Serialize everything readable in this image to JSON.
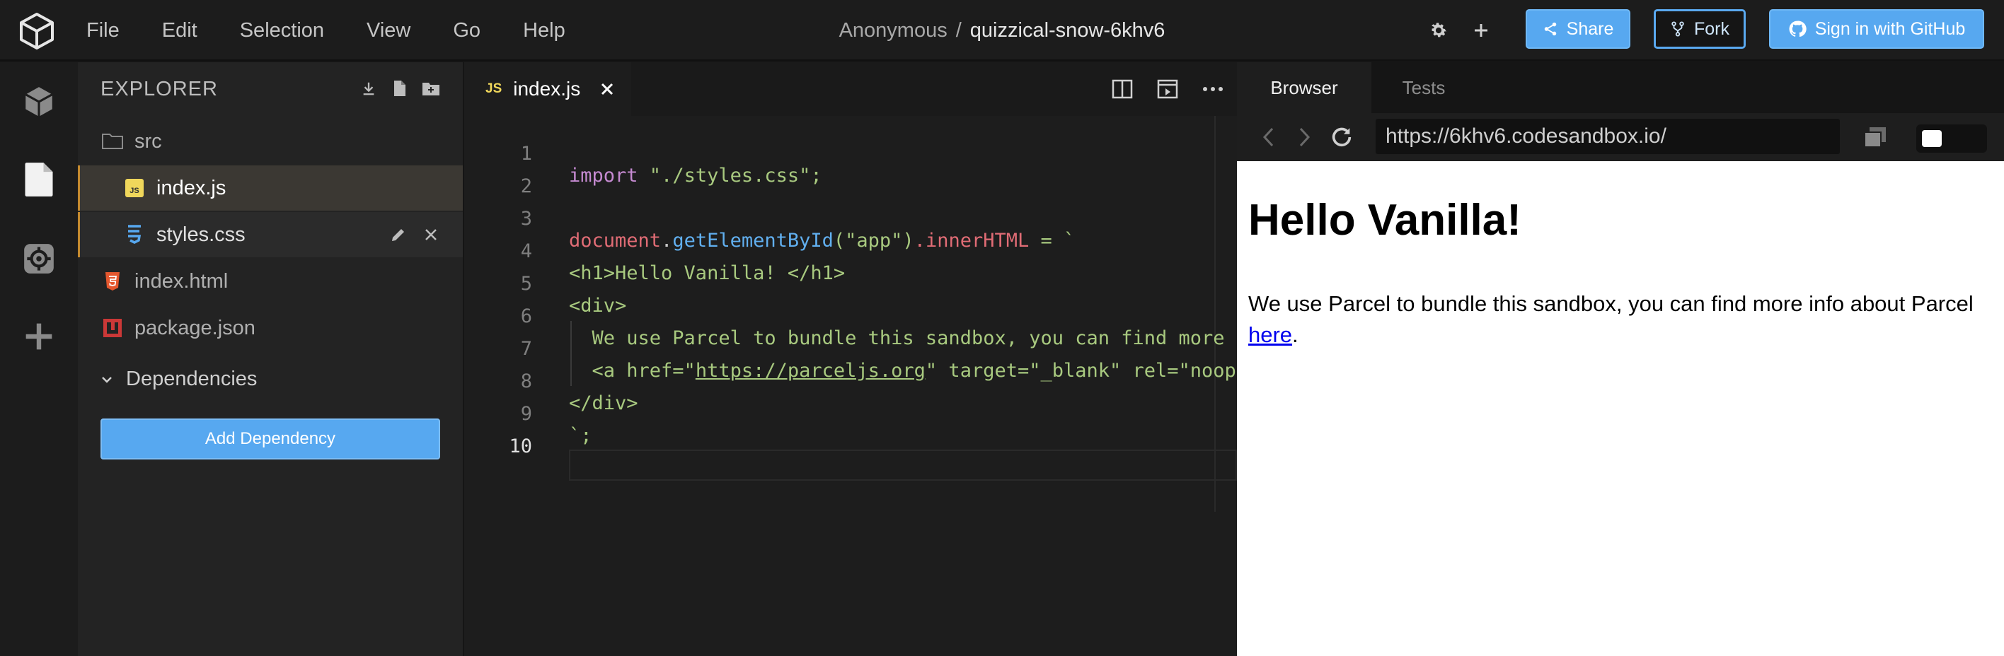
{
  "menu": [
    "File",
    "Edit",
    "Selection",
    "View",
    "Go",
    "Help"
  ],
  "project": {
    "user": "Anonymous",
    "separator": "/",
    "name": "quizzical-snow-6khv6"
  },
  "buttons": {
    "share": "Share",
    "fork": "Fork",
    "github": "Sign in with GitHub"
  },
  "explorer": {
    "title": "EXPLORER",
    "files": [
      {
        "name": "src",
        "icon": "folder-icon"
      },
      {
        "name": "index.js",
        "icon": "js-file-icon"
      },
      {
        "name": "styles.css",
        "icon": "css-file-icon"
      },
      {
        "name": "index.html",
        "icon": "html-file-icon"
      },
      {
        "name": "package.json",
        "icon": "npm-package-icon"
      }
    ],
    "dependencies_label": "Dependencies",
    "add_dependency": "Add Dependency"
  },
  "editor": {
    "tab": {
      "badge": "JS",
      "label": "index.js"
    },
    "line_numbers": [
      "1",
      "2",
      "3",
      "4",
      "5",
      "6",
      "7",
      "8",
      "9",
      "10"
    ],
    "lines": {
      "l1": {
        "kw": "import",
        "str": " \"./styles.css\";"
      },
      "l3": {
        "ident": "document",
        "dot": ".",
        "fn": "getElementById",
        "arg": "(\"app\")",
        "prop": ".innerHTML",
        "eq": " = `"
      },
      "l4": "<h1>Hello Vanilla! </h1>",
      "l5": "<div>",
      "l6": "  We use Parcel to bundle this sandbox, you can find more info about",
      "l7a": "  <a href=\"",
      "l7url": "https://parceljs.org",
      "l7b": "\" target=\"_blank\" rel=\"noopener noreferrer\">here</a>.",
      "l8": "</div>",
      "l9": "`;"
    }
  },
  "browser": {
    "tabs": [
      "Browser",
      "Tests"
    ],
    "url": "https://6khv6.codesandbox.io/",
    "heading": "Hello Vanilla!",
    "paragraph_text": "We use Parcel to bundle this sandbox, you can find more info about Parcel ",
    "link_text": "here",
    "paragraph_end": "."
  },
  "colors": {
    "accent": "#57a8f0",
    "active_file_border": "#c48a2f",
    "js_badge": "#f0d75b"
  }
}
